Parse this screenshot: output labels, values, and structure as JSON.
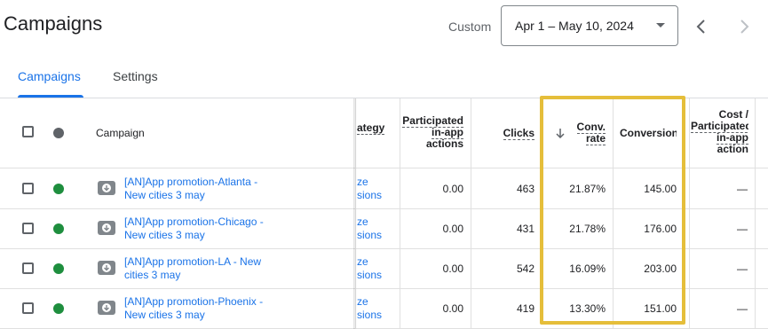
{
  "header": {
    "title": "Campaigns",
    "custom_label": "Custom",
    "date_range": "Apr 1 – May 10, 2024"
  },
  "tabs": [
    {
      "label": "Campaigns",
      "active": true
    },
    {
      "label": "Settings",
      "active": false
    }
  ],
  "table": {
    "columns": {
      "campaign": "Campaign",
      "strategy": "ategy",
      "participated_1": "Participated",
      "participated_2": "in-app",
      "participated_3": "actions",
      "clicks": "Clicks",
      "conv_rate_1": "Conv.",
      "conv_rate_2": "rate",
      "conversions": "Conversions",
      "cost_1": "Cost /",
      "cost_2": "Participated",
      "cost_3": "in-app",
      "cost_4": "action"
    },
    "rows": [
      {
        "campaign_line1": "[AN]App promotion-Atlanta -",
        "campaign_line2": "New cities 3 may",
        "strategy_line1": "ze",
        "strategy_line2": "sions",
        "participated": "0.00",
        "clicks": "463",
        "conv_rate": "21.87%",
        "conversions": "145.00",
        "cost": "—"
      },
      {
        "campaign_line1": "[AN]App promotion-Chicago -",
        "campaign_line2": "New cities 3 may",
        "strategy_line1": "ze",
        "strategy_line2": "sions",
        "participated": "0.00",
        "clicks": "431",
        "conv_rate": "21.78%",
        "conversions": "176.00",
        "cost": "—"
      },
      {
        "campaign_line1": "[AN]App promotion-LA - New",
        "campaign_line2": "cities 3 may",
        "strategy_line1": "ze",
        "strategy_line2": "sions",
        "participated": "0.00",
        "clicks": "542",
        "conv_rate": "16.09%",
        "conversions": "203.00",
        "cost": "—"
      },
      {
        "campaign_line1": "[AN]App promotion-Phoenix -",
        "campaign_line2": "New cities 3 may",
        "strategy_line1": "ze",
        "strategy_line2": "sions",
        "participated": "0.00",
        "clicks": "419",
        "conv_rate": "13.30%",
        "conversions": "151.00",
        "cost": "—"
      }
    ]
  },
  "colors": {
    "accent": "#1a73e8",
    "status_enabled": "#1e8e3e",
    "highlight": "#e5be3a"
  },
  "icons": [
    "chevron-left-icon",
    "chevron-right-icon",
    "dropdown-caret-icon",
    "sort-down-arrow-icon",
    "app-download-icon"
  ]
}
